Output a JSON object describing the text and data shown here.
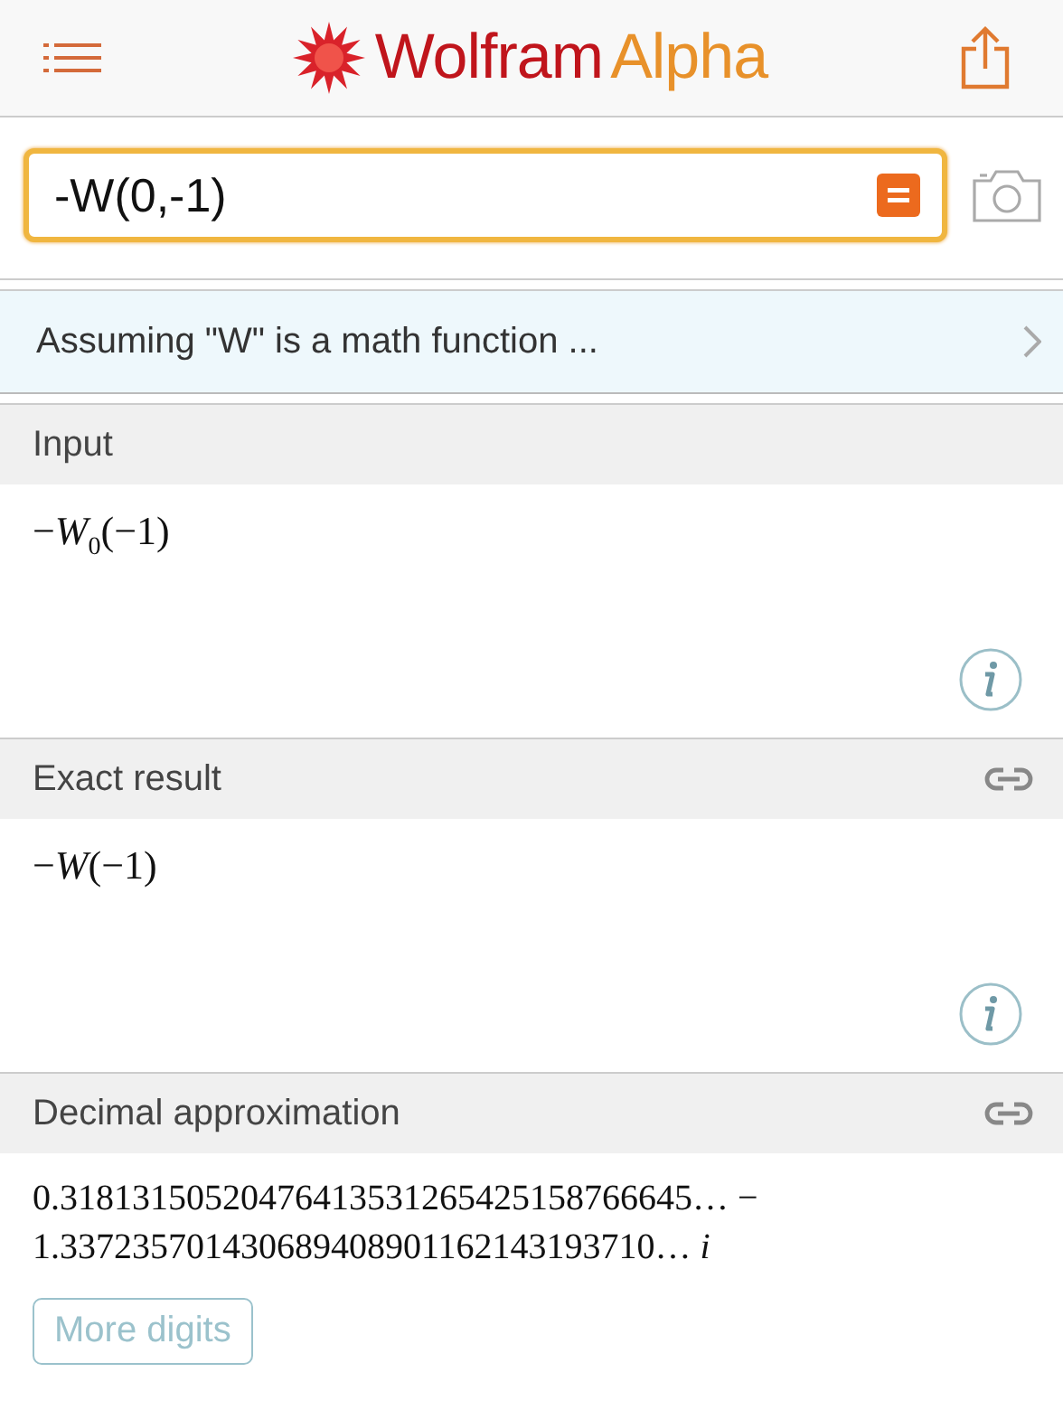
{
  "header": {
    "logo_primary": "Wolfram",
    "logo_secondary": "Alpha"
  },
  "search": {
    "value": "-W(0,-1)"
  },
  "assumption": {
    "text": "Assuming \"W\" is a math function ..."
  },
  "pods": [
    {
      "title": "Input",
      "link": false,
      "lines": [
        "−*W*$_{0}$(−1)"
      ],
      "info": true
    },
    {
      "title": "Exact result",
      "link": true,
      "lines": [
        "−*W*(−1)"
      ],
      "info": true
    },
    {
      "title": "Decimal approximation",
      "link": true,
      "lines": [
        "0.31813150520476413531265425158766645… −",
        "1.337235701430689408901162143193710… *i*"
      ],
      "info": false,
      "button": "More digits"
    }
  ]
}
